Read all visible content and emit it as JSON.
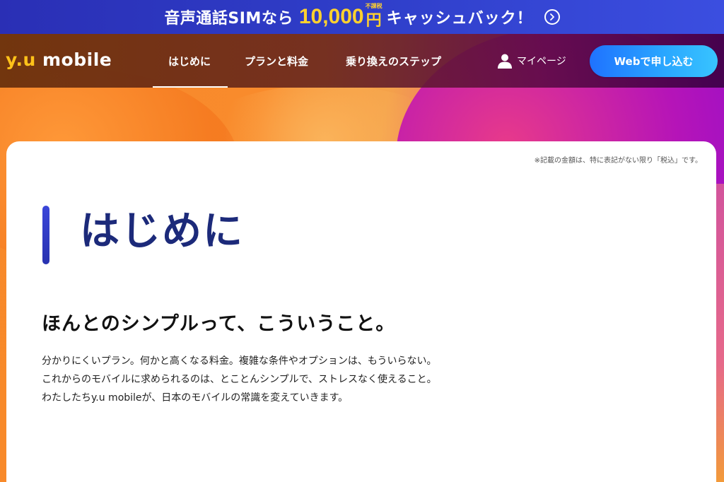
{
  "promo": {
    "text_before": "音声通話SIMなら",
    "amount": "10,000",
    "tax_label": "不課税",
    "yen": "円",
    "text_after": "キャッシュバック！",
    "arrow_icon": "chevron-right-circle-icon"
  },
  "nav": {
    "logo_prefix": "y.u",
    "logo_suffix": " mobile",
    "items": [
      {
        "label": "はじめに",
        "active": true
      },
      {
        "label": "プランと料金",
        "active": false
      },
      {
        "label": "乗り換えのステップ",
        "active": false
      }
    ],
    "mypage_label": "マイページ",
    "mypage_icon": "person-icon",
    "apply_label": "Webで申し込む"
  },
  "content": {
    "tax_note": "※記載の金額は、特に表記がない限り「税込」です。",
    "title": "はじめに",
    "subheading": "ほんとのシンプルって、こういうこと。",
    "body_lines": [
      "分かりにくいプラン。何かと高くなる料金。複雑な条件やオプションは、もういらない。",
      "これからのモバイルに求められるのは、とことんシンプルで、ストレスなく使えること。",
      "わたしたちy.u mobileが、日本のモバイルの常識を変えていきます。"
    ]
  },
  "colors": {
    "promo_bg": "#2f3ec9",
    "promo_accent": "#ffd12e",
    "logo_accent": "#ffc21a",
    "title_color": "#1c2a7a",
    "apply_button": "#2aa8ff"
  }
}
